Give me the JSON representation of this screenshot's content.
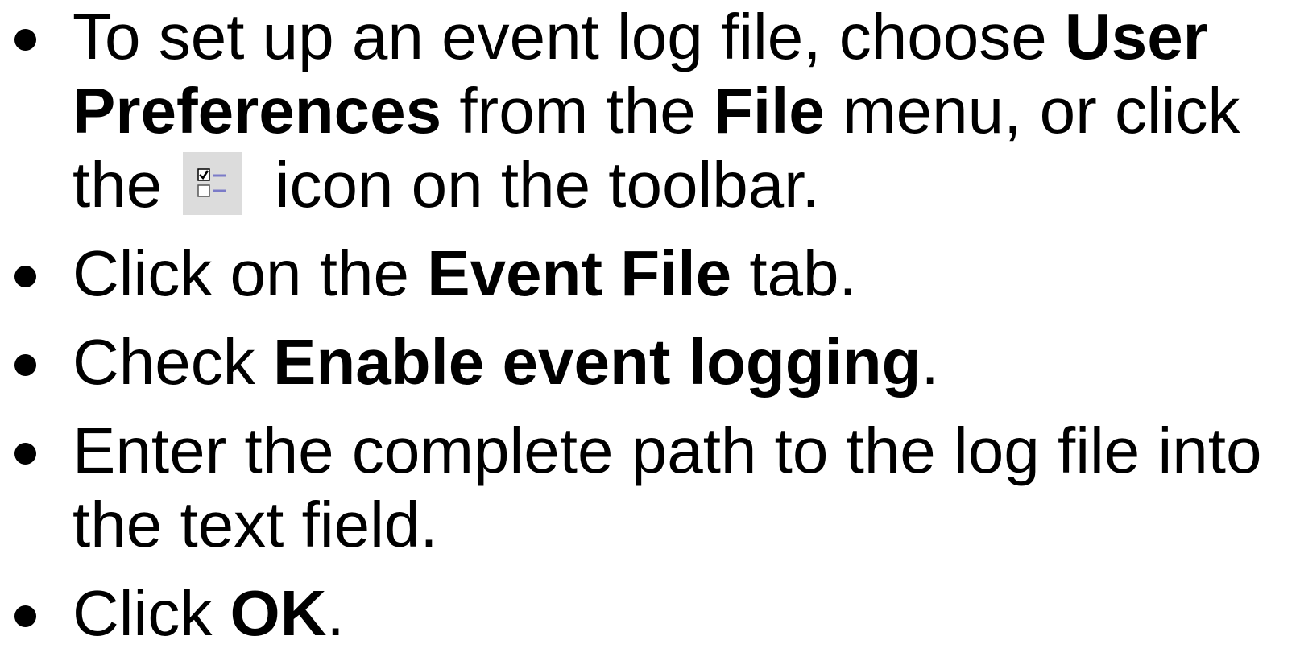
{
  "bullets": [
    {
      "parts": {
        "t1": "To set up an event log file, choose ",
        "b1": "User Preferences",
        "t2": " from the ",
        "b2": "File",
        "t3": " menu, or click the ",
        "t4": " icon on the toolbar."
      },
      "icon": "user-preferences-checklist-icon"
    },
    {
      "parts": {
        "t1": "Click on the ",
        "b1": "Event File",
        "t2": " tab."
      }
    },
    {
      "parts": {
        "t1": "Check ",
        "b1": "Enable event logging",
        "t2": "."
      }
    },
    {
      "parts": {
        "t1": "Enter the complete path to the log file into the text field."
      }
    },
    {
      "parts": {
        "t1": "Click ",
        "b1": "OK",
        "t2": "."
      }
    }
  ],
  "colors": {
    "text": "#000000",
    "background": "#ffffff",
    "icon_background": "#dcdcdc",
    "icon_accent": "#7b7bc8"
  }
}
